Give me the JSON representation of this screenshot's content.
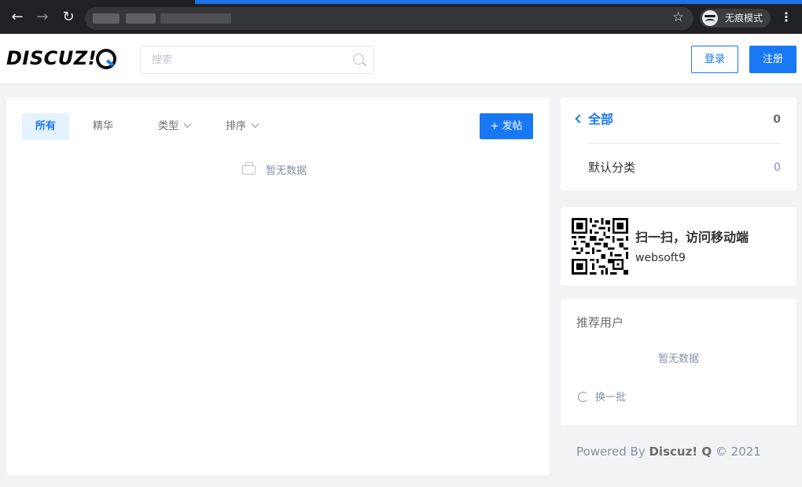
{
  "browser": {
    "back_icon": "arrow-left-icon",
    "forward_icon": "arrow-right-icon",
    "reload_icon": "reload-icon",
    "bookmark_icon": "star-icon",
    "incognito_label": "无痕模式",
    "menu_icon": "kebab-icon",
    "accent": "#1a73e8"
  },
  "header": {
    "logo_text": "DISCUZ!",
    "search_placeholder": "搜索",
    "login_label": "登录",
    "register_label": "注册",
    "brand_color": "#1878f3"
  },
  "main": {
    "tabs": [
      {
        "label": "所有",
        "active": true
      },
      {
        "label": "精华",
        "active": false
      },
      {
        "label": "类型",
        "active": false,
        "dropdown": true
      },
      {
        "label": "排序",
        "active": false,
        "dropdown": true
      }
    ],
    "post_button_label": "+ 发帖",
    "empty_text": "暂无数据"
  },
  "sidebar": {
    "categories": {
      "title": "全部",
      "total_count": "0",
      "items": [
        {
          "label": "默认分类",
          "count": "0"
        }
      ]
    },
    "qr": {
      "title": "扫一扫，访问移动端",
      "subtitle": "websoft9"
    },
    "recommended_users": {
      "title": "推荐用户",
      "empty_text": "暂无数据",
      "refresh_label": "换一批"
    },
    "footer": {
      "prefix": "Powered By ",
      "brand": "Discuz! Q",
      "suffix": " © 2021"
    }
  }
}
